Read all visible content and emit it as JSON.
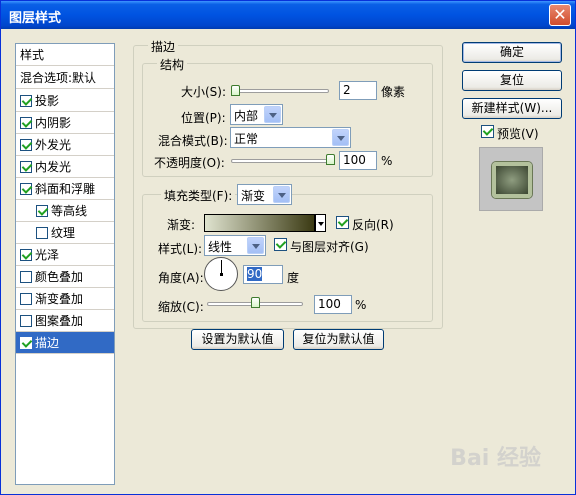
{
  "window": {
    "title": "图层样式",
    "close_glyph": "✕"
  },
  "left_panel": {
    "header": "样式",
    "blend": "混合选项:默认",
    "items": [
      {
        "label": "投影",
        "checked": true,
        "indent": false,
        "selected": false
      },
      {
        "label": "内阴影",
        "checked": true,
        "indent": false,
        "selected": false
      },
      {
        "label": "外发光",
        "checked": true,
        "indent": false,
        "selected": false
      },
      {
        "label": "内发光",
        "checked": true,
        "indent": false,
        "selected": false
      },
      {
        "label": "斜面和浮雕",
        "checked": true,
        "indent": false,
        "selected": false
      },
      {
        "label": "等高线",
        "checked": true,
        "indent": true,
        "selected": false
      },
      {
        "label": "纹理",
        "checked": false,
        "indent": true,
        "selected": false
      },
      {
        "label": "光泽",
        "checked": true,
        "indent": false,
        "selected": false
      },
      {
        "label": "颜色叠加",
        "checked": false,
        "indent": false,
        "selected": false
      },
      {
        "label": "渐变叠加",
        "checked": false,
        "indent": false,
        "selected": false
      },
      {
        "label": "图案叠加",
        "checked": false,
        "indent": false,
        "selected": false
      },
      {
        "label": "描边",
        "checked": true,
        "indent": false,
        "selected": true
      }
    ]
  },
  "stroke": {
    "title": "描边",
    "structure_title": "结构",
    "size_label": "大小(S):",
    "size_value": "2",
    "size_unit": "像素",
    "size_fraction": 0.0,
    "position_label": "位置(P):",
    "position_value": "内部",
    "blend_label": "混合模式(B):",
    "blend_value": "正常",
    "opacity_label": "不透明度(O):",
    "opacity_value": "100",
    "opacity_unit": "%",
    "opacity_fraction": 1.0,
    "fill_type_label": "填充类型(F):",
    "fill_type_value": "渐变",
    "gradient_label": "渐变:",
    "reverse_label": "反向(R)",
    "reverse_checked": true,
    "style_label": "样式(L):",
    "style_value": "线性",
    "align_label": "与图层对齐(G)",
    "align_checked": true,
    "angle_label": "角度(A):",
    "angle_value": "90",
    "angle_unit": "度",
    "scale_label": "缩放(C):",
    "scale_value": "100",
    "scale_unit": "%",
    "scale_fraction": 0.5,
    "set_default": "设置为默认值",
    "reset_default": "复位为默认值"
  },
  "right": {
    "ok": "确定",
    "reset": "复位",
    "new_style": "新建样式(W)...",
    "preview_label": "预览(V)",
    "preview_checked": true
  },
  "watermark": "Bai 经验"
}
